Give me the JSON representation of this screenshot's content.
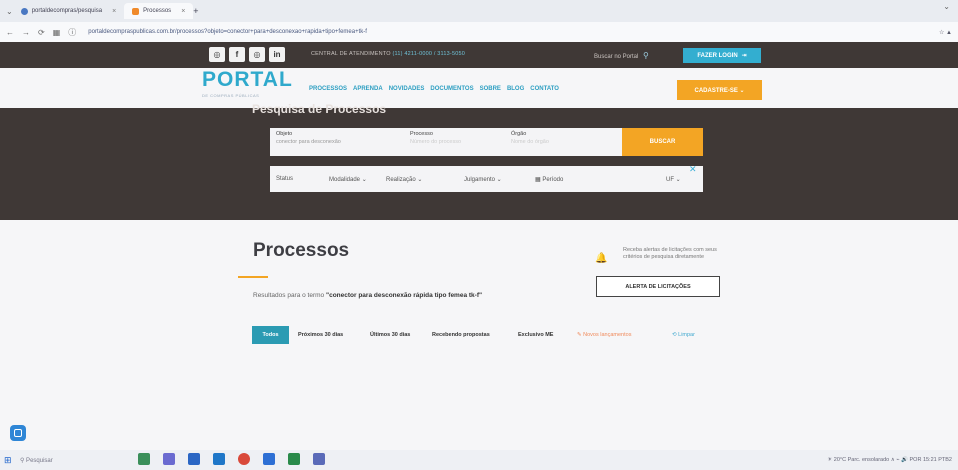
{
  "browser": {
    "tab1": "portaldecompras/pesquisa",
    "tab2": "Processos",
    "tab_close": "×",
    "new_tab": "+",
    "address": "portaldecompraspublicas.com.br/processos?objeto=conector+para+desconexao+rapida+tipo+femea+tk-f",
    "ext": "☆   ▲"
  },
  "topbar": {
    "social": [
      "◎",
      "f",
      "◎",
      "in"
    ],
    "central_text": "CENTRAL DE ATENDIMENTO",
    "central_phone": "(11) 4211-0000 / 3113-5050",
    "search_label": "Buscar no Portal",
    "search_icon": "⚲",
    "login_label": "FAZER LOGIN",
    "login_icon": "⇥"
  },
  "header": {
    "logo": "PORTAL",
    "logo_sub": "DE COMPRAS PÚBLICAS",
    "menu": [
      "PROCESSOS",
      "APRENDA",
      "NOVIDADES",
      "DOCUMENTOS",
      "SOBRE",
      "BLOG",
      "CONTATO"
    ],
    "cadastre": "CADASTRE-SE ⌄"
  },
  "search": {
    "title": "Pesquisa de Processos",
    "objeto_label": "Objeto",
    "objeto_value": "conector para desconexão",
    "processo_label": "Processo",
    "processo_value": "Número do processo",
    "orgao_label": "Órgão",
    "orgao_value": "Nome do órgão",
    "buscar": "BUSCAR",
    "status": "Status",
    "modalidade": "Modalidade ⌄",
    "realizacao": "Realização ⌄",
    "julgamento": "Julgamento ⌄",
    "periodo": "▦ Período",
    "uf": "UF ⌄",
    "close": "✕"
  },
  "main": {
    "title": "Processos",
    "result_prefix": "Resultados para o termo",
    "result_term": "\"conector para desconexão rápida tipo femea tk-f\"",
    "alert_text": "Receba alertas de licitações com seus critérios de pesquisa diretamente",
    "alert_button": "ALERTA DE LICITAÇÕES",
    "bell_icon": "🔔",
    "filters": {
      "todos": "Todos",
      "proximos": "Próximos 30 dias",
      "ultimos": "Últimos 30 dias",
      "recebendo": "Recebendo propostas",
      "exclusivo": "Exclusivo ME",
      "novos": "✎ Novos lançamentos",
      "limpar": "⟲ Limpar"
    }
  },
  "taskbar": {
    "start": "⊞",
    "search": "⚲ Pesquisar",
    "tray": "☀ 20°C Parc. ensolarado   ∧  ⌁  🔊  POR  15:21  PTB2"
  },
  "colors": {
    "dark": "#3f3836",
    "teal": "#33aed0",
    "orange": "#f3a524"
  }
}
